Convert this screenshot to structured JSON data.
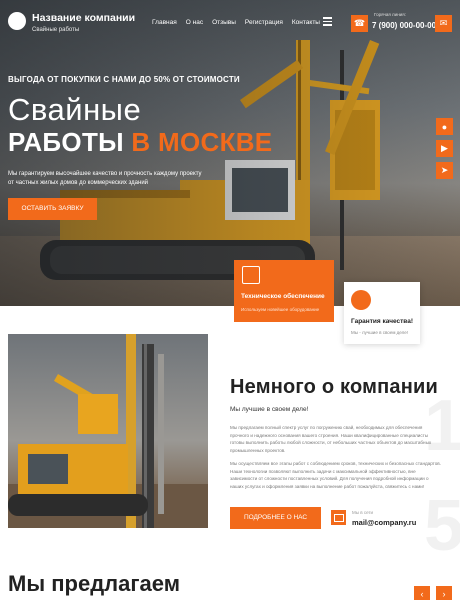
{
  "header": {
    "company_name": "Название компании",
    "company_tagline": "Свайные работы",
    "nav": [
      "Главная",
      "О нас",
      "Отзывы",
      "Регистрация",
      "Контакты"
    ],
    "phone_label": "Горячая линия:",
    "phone": "7 (900) 000-00-00"
  },
  "hero": {
    "tagline": "ВЫГОДА ОТ ПОКУПКИ С НАМИ ДО 50% ОТ СТОИМОСТИ",
    "title_line1": "Свайные",
    "title_line2_white": "РАБОТЫ ",
    "title_line2_orange": "В МОСКВЕ",
    "description": "Мы гарантируем высочайшее качество и прочность каждому проекту от частных жилых домов до коммерческих зданий",
    "cta_label": "ОСТАВИТЬ ЗАЯВКУ"
  },
  "features": [
    {
      "title": "Техническое обеспечение",
      "subtitle": "Используем новейшее оборудование"
    },
    {
      "title": "Гарантия качества!",
      "subtitle": "Мы - лучшие в своем деле!"
    }
  ],
  "about": {
    "title": "Немного о компании",
    "subtitle": "Мы лучшие в своем деле!",
    "paragraph1": "Мы предлагаем полный спектр услуг по погружению свай, необходимых для обеспечения прочного и надежного основания вашего строения. Наши квалифицированные специалисты готовы выполнить работы любой сложности, от небольших частных объектов до масштабных промышленных проектов.",
    "paragraph2": "Мы осуществляем все этапы работ с соблюдением сроков, технических и безопасных стандартов. Наши технологии позволяют выполнить задачи с максимальной эффективностью, вне зависимости от сложности поставленных условий. Для получения подробной информации о наших услугах и оформления заявки на выполнение работ пожалуйста, свяжитесь с нами!",
    "button_label": "ПОДРОБНЕЕ О НАС",
    "mail_label": "Мы в сети",
    "mail": "mail@company.ru"
  },
  "offer": {
    "title": "Мы предлагаем"
  },
  "colors": {
    "accent": "#f26a1b",
    "dark": "#222222"
  },
  "icons": {
    "hero_social": [
      "vk-icon",
      "youtube-icon",
      "telegram-icon"
    ],
    "top_buttons": [
      "phone-icon",
      "viber-icon"
    ]
  }
}
